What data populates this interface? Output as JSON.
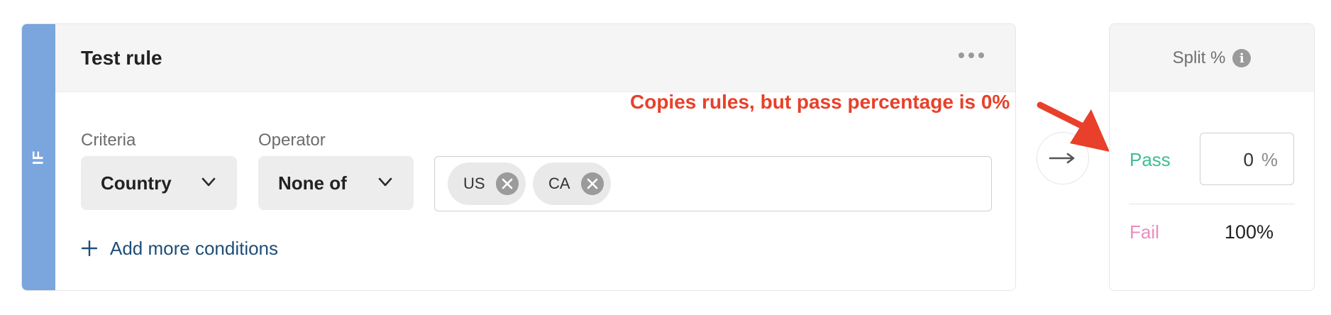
{
  "rule": {
    "side_label": "IF",
    "title": "Test rule",
    "more_menu_icon": "more-horizontal-icon",
    "criteria": {
      "label": "Criteria",
      "value": "Country"
    },
    "operator": {
      "label": "Operator",
      "value": "None of"
    },
    "values": [
      {
        "label": "US"
      },
      {
        "label": "CA"
      }
    ],
    "add_conditions_label": "Add more conditions"
  },
  "connector_icon": "arrow-right-icon",
  "annotation": {
    "text": "Copies rules, but pass percentage is 0%",
    "color": "#e8402a"
  },
  "split": {
    "title": "Split %",
    "info_icon": "i",
    "pass": {
      "label": "Pass",
      "value": "0",
      "unit": "%",
      "color": "#3dbf93"
    },
    "fail": {
      "label": "Fail",
      "value": "100%",
      "color": "#e98cc0"
    }
  },
  "colors": {
    "if_strip": "#7aa5dd",
    "link": "#1f4e79"
  }
}
